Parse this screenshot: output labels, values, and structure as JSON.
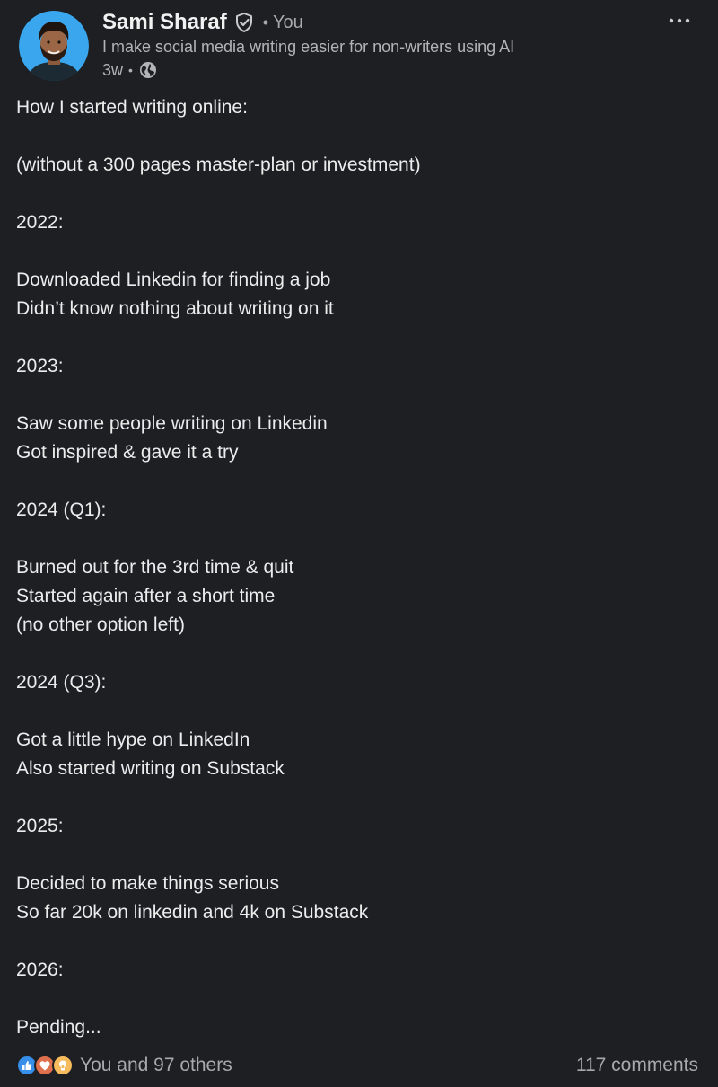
{
  "author": {
    "name": "Sami Sharaf",
    "relation": "You",
    "headline": "I make social media writing easier for non-writers using AI",
    "post_age": "3w",
    "avatar_bg": "#3aa6ee"
  },
  "icons": {
    "verified": "verified-shield-icon",
    "visibility": "globe-icon",
    "menu": "more-options-icon",
    "reactions": [
      "like-icon",
      "love-icon",
      "insightful-icon"
    ]
  },
  "colors": {
    "background": "#1d1f23",
    "text": "#ececec",
    "secondary_text": "#a7a9ad",
    "like": "#378fe9",
    "love": "#df704d",
    "insightful": "#f5bb5c"
  },
  "post": {
    "lines": [
      "How I started writing online:",
      "",
      "(without a 300 pages master-plan or investment)",
      "",
      "2022:",
      "",
      "Downloaded Linkedin for finding a job",
      "Didn’t know nothing about writing on it",
      "",
      "2023:",
      "",
      "Saw some people writing on Linkedin",
      "Got inspired & gave it a try",
      "",
      "2024 (Q1):",
      "",
      "Burned out for the 3rd time & quit",
      "Started again after a short time",
      "(no other option left)",
      "",
      "2024 (Q3):",
      "",
      "Got a little hype on LinkedIn",
      "Also started writing on Substack",
      "",
      "2025:",
      "",
      "Decided to make things serious",
      "So far 20k on linkedin and 4k on Substack",
      "",
      "2026:",
      "",
      "Pending..."
    ]
  },
  "footer": {
    "reactions_text": "You and 97 others",
    "comments_text": "117 comments"
  }
}
